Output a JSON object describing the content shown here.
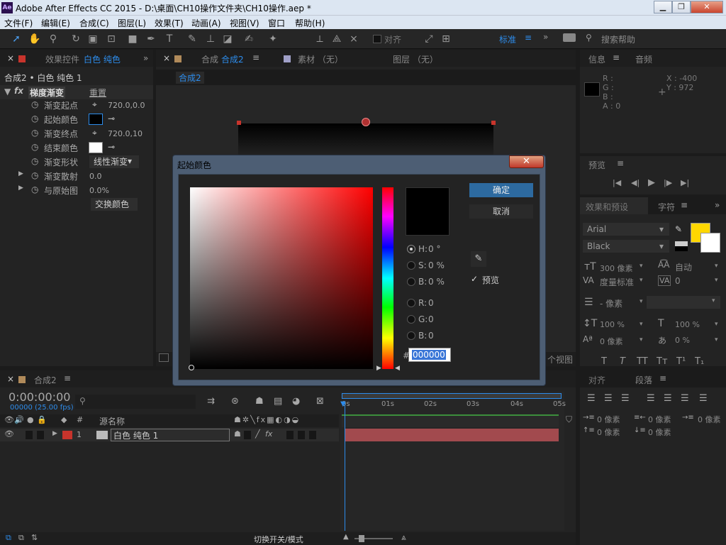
{
  "window": {
    "logo": "Ae",
    "title": "Adobe After Effects CC 2015 - D:\\桌面\\CH10操作文件夹\\CH10操作.aep *",
    "min": "▁",
    "max": "❐",
    "close": "✕"
  },
  "menu": [
    "文件(F)",
    "编辑(E)",
    "合成(C)",
    "图层(L)",
    "效果(T)",
    "动画(A)",
    "视图(V)",
    "窗口",
    "帮助(H)"
  ],
  "toolbar": {
    "align_label": "对齐",
    "workspace": "标准",
    "search_placeholder": "搜索帮助"
  },
  "effects_panel": {
    "tab_label": "效果控件",
    "tab_layer": "白色 纯色",
    "tab_more": "»",
    "breadcrumb": "合成2 • 白色 纯色 1",
    "effect_name": "梯度渐变",
    "reset": "重置",
    "props": [
      {
        "label": "渐变起点",
        "value": "720.0,0.0"
      },
      {
        "label": "起始颜色",
        "value": ""
      },
      {
        "label": "渐变终点",
        "value": "720.0,10"
      },
      {
        "label": "结束颜色",
        "value": ""
      },
      {
        "label": "渐变形状",
        "value": "线性渐变"
      },
      {
        "label": "渐变散射",
        "value": "0.0"
      },
      {
        "label": "与原始图",
        "value": "0.0%"
      }
    ],
    "swap_button": "交换颜色"
  },
  "comp_panel": {
    "tab_prefix": "合成",
    "tab_name": "合成2",
    "tab_footage": "素材 （无）",
    "tab_layer": "图层 （无）",
    "sub_tab": "合成2",
    "views_label": "个视图"
  },
  "info_panel": {
    "tab_info": "信息",
    "tab_audio": "音频",
    "r": "R :",
    "g": "G :",
    "b": "B :",
    "a": "A : 0",
    "x": "X : -400",
    "y": "Y : 972"
  },
  "preview_panel": {
    "title": "预览"
  },
  "effects_presets": {
    "tab": "效果和预设",
    "tab_char": "字符"
  },
  "character": {
    "font": "Arial",
    "style": "Black",
    "size": "300 像素",
    "leading": "自动",
    "kerning": "度量标准",
    "tracking": "0",
    "stroke": "- 像素",
    "vscale": "100 %",
    "hscale": "100 %",
    "baseline": "0 像素",
    "tsume": "0 %",
    "fill_color": "#ffd700"
  },
  "paragraph": {
    "tab_align": "对齐",
    "tab_para": "段落",
    "indent_left": "0 像素",
    "indent_right": "0 像素",
    "indent_first": "0 像素",
    "space_before": "0 像素",
    "space_after": "0 像素"
  },
  "timeline": {
    "tab": "合成2",
    "timecode": "0:00:00:00",
    "frames": "00000 (25.00 fps)",
    "col_hash": "#",
    "col_source": "源名称",
    "layer_num": "1",
    "layer_name": "白色 纯色 1",
    "ruler": [
      "0s",
      "01s",
      "02s",
      "03s",
      "04s",
      "05s"
    ],
    "footer_toggle": "切换开关/模式"
  },
  "dialog": {
    "title": "起始颜色",
    "ok": "确定",
    "cancel": "取消",
    "preview": "预览",
    "h_label": "H:",
    "h_value": "0 °",
    "s_label": "S:",
    "s_value": "0 %",
    "b_label": "B:",
    "b_value": "0 %",
    "r_label": "R:",
    "r_value": "0",
    "g_label": "G:",
    "g_value": "0",
    "b2_label": "B:",
    "b2_value": "0",
    "hex_prefix": "#",
    "hex_value": "000000",
    "current_color": "#000000"
  }
}
